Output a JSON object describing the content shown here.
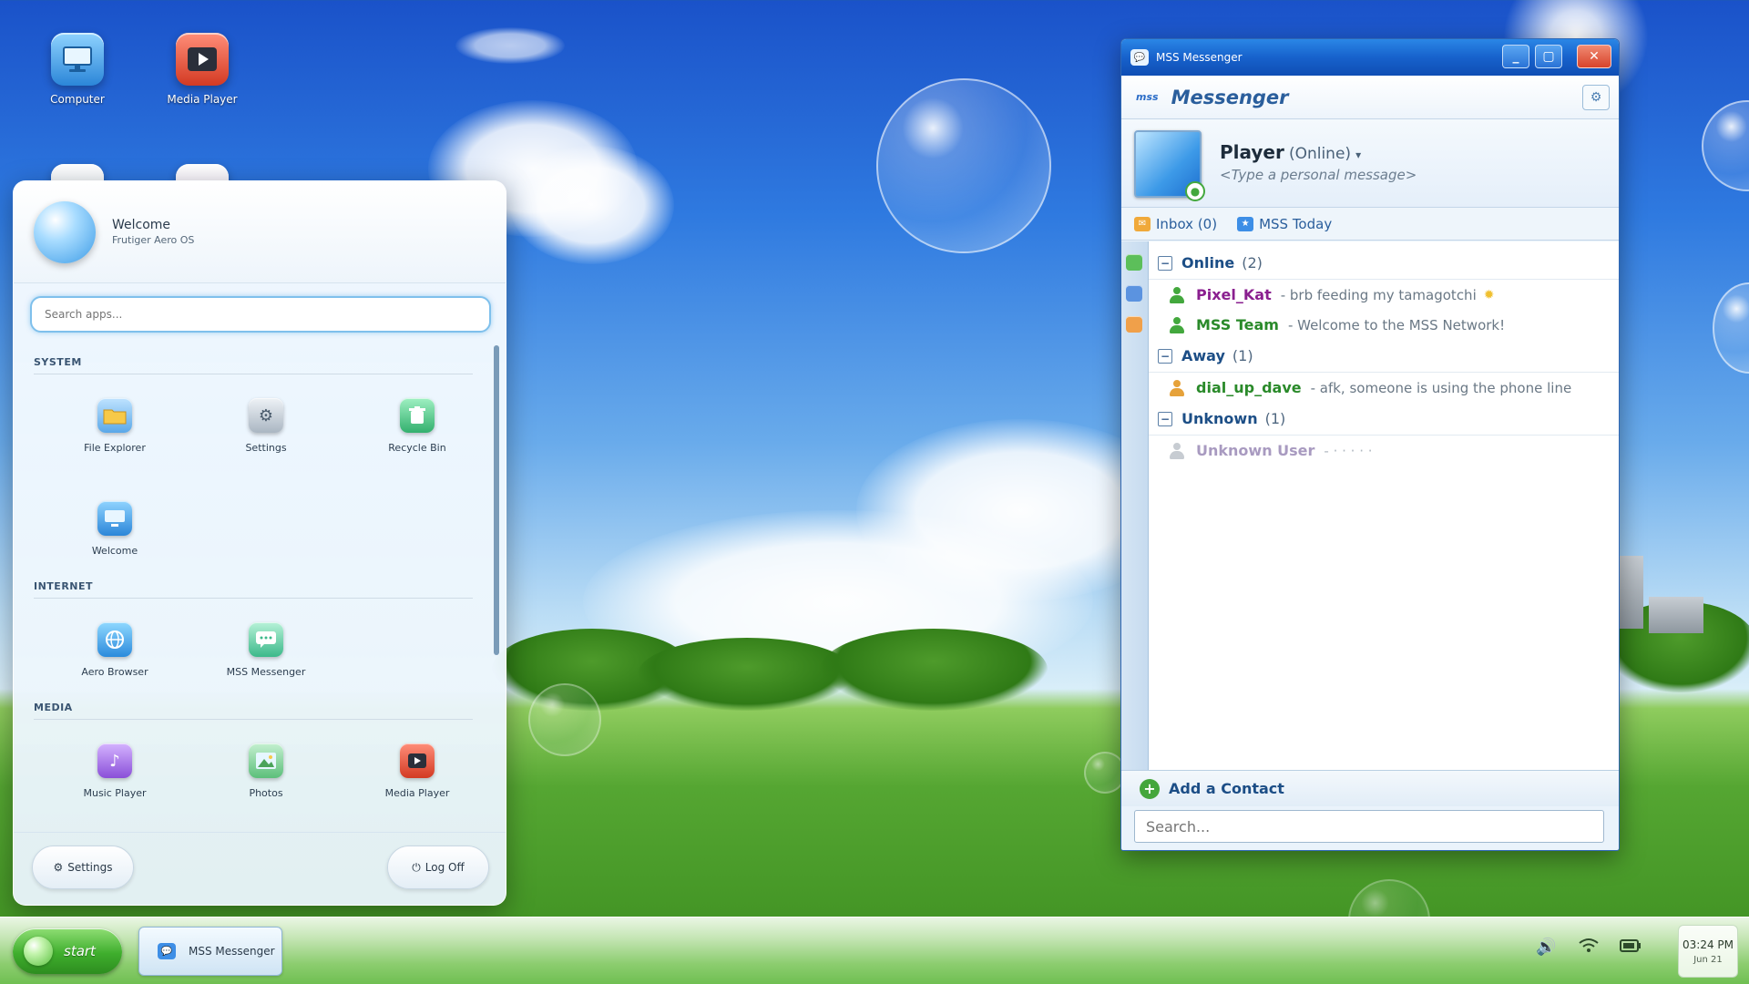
{
  "desktop": {
    "icons": [
      {
        "label": "Computer"
      },
      {
        "label": "Media Player"
      }
    ]
  },
  "start_menu": {
    "welcome": "Welcome",
    "os_name": "Frutiger Aero OS",
    "search_placeholder": "Search apps...",
    "sections": [
      {
        "title": "SYSTEM",
        "apps": [
          "File Explorer",
          "Settings",
          "Recycle Bin",
          "Welcome"
        ]
      },
      {
        "title": "INTERNET",
        "apps": [
          "Aero Browser",
          "MSS Messenger"
        ]
      },
      {
        "title": "MEDIA",
        "apps": [
          "Music Player",
          "Photos",
          "Media Player"
        ]
      }
    ],
    "settings_label": "Settings",
    "logoff_label": "Log Off"
  },
  "messenger": {
    "window_title": "MSS Messenger",
    "logo_text": "mss",
    "header_title": "Messenger",
    "profile": {
      "name": "Player",
      "status": "(Online)",
      "personal_message": "<Type a personal message>"
    },
    "links": {
      "inbox": "Inbox (0)",
      "today": "MSS Today"
    },
    "groups": [
      {
        "name": "Online",
        "count": "(2)",
        "contacts": [
          {
            "name": "Pixel_Kat",
            "note": "- brb feeding my tamagotchi",
            "color": "#8a1f8f"
          },
          {
            "name": "MSS Team",
            "note": "- Welcome to the MSS Network!",
            "color": "#2a8a2a"
          }
        ]
      },
      {
        "name": "Away",
        "count": "(1)",
        "contacts": [
          {
            "name": "dial_up_dave",
            "note": "- afk, someone is using the phone line",
            "color": "#2a8a2a"
          }
        ]
      },
      {
        "name": "Unknown",
        "count": "(1)",
        "contacts": [
          {
            "name": "Unknown User",
            "note": "- · · · · ·",
            "color": "#a89ac0"
          }
        ]
      }
    ],
    "add_contact": "Add a Contact",
    "search_placeholder": "Search..."
  },
  "taskbar": {
    "start_label": "start",
    "active_task": "MSS Messenger",
    "time": "03:24 PM",
    "date": "Jun 21"
  },
  "colors": {
    "accent": "#1762cc",
    "online": "#43a83d",
    "away": "#e6a23a"
  }
}
